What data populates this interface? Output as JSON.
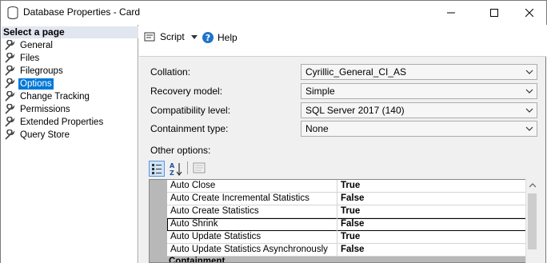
{
  "window": {
    "title": "Database Properties - Card",
    "icons": {
      "app": "database-icon",
      "minimize": "minimize-icon",
      "maximize": "maximize-icon",
      "close": "close-icon"
    }
  },
  "sidebar": {
    "header": "Select a page",
    "items": [
      {
        "label": "General"
      },
      {
        "label": "Files"
      },
      {
        "label": "Filegroups"
      },
      {
        "label": "Options",
        "selected": true
      },
      {
        "label": "Change Tracking"
      },
      {
        "label": "Permissions"
      },
      {
        "label": "Extended Properties"
      },
      {
        "label": "Query Store"
      }
    ],
    "item_icon": "wrench-icon"
  },
  "toolbar": {
    "script_label": "Script",
    "help_label": "Help"
  },
  "form": {
    "collation": {
      "label": "Collation:",
      "value": "Cyrillic_General_CI_AS"
    },
    "recovery_model": {
      "label": "Recovery model:",
      "value": "Simple"
    },
    "compatibility_level": {
      "label": "Compatibility level:",
      "value": "SQL Server 2017 (140)"
    },
    "containment_type": {
      "label": "Containment type:",
      "value": "None"
    },
    "other_options_label": "Other options:"
  },
  "grid": {
    "rows": [
      {
        "name": "Auto Close",
        "value": "True"
      },
      {
        "name": "Auto Create Incremental Statistics",
        "value": "False"
      },
      {
        "name": "Auto Create Statistics",
        "value": "True"
      },
      {
        "name": "Auto Shrink",
        "value": "False",
        "selected": true
      },
      {
        "name": "Auto Update Statistics",
        "value": "True"
      },
      {
        "name": "Auto Update Statistics Asynchronously",
        "value": "False"
      }
    ],
    "next_category": "Containment"
  },
  "colors": {
    "selection": "#0078d7",
    "header_bg": "#e1e6f0",
    "panel_bg": "#f0f0f0"
  }
}
